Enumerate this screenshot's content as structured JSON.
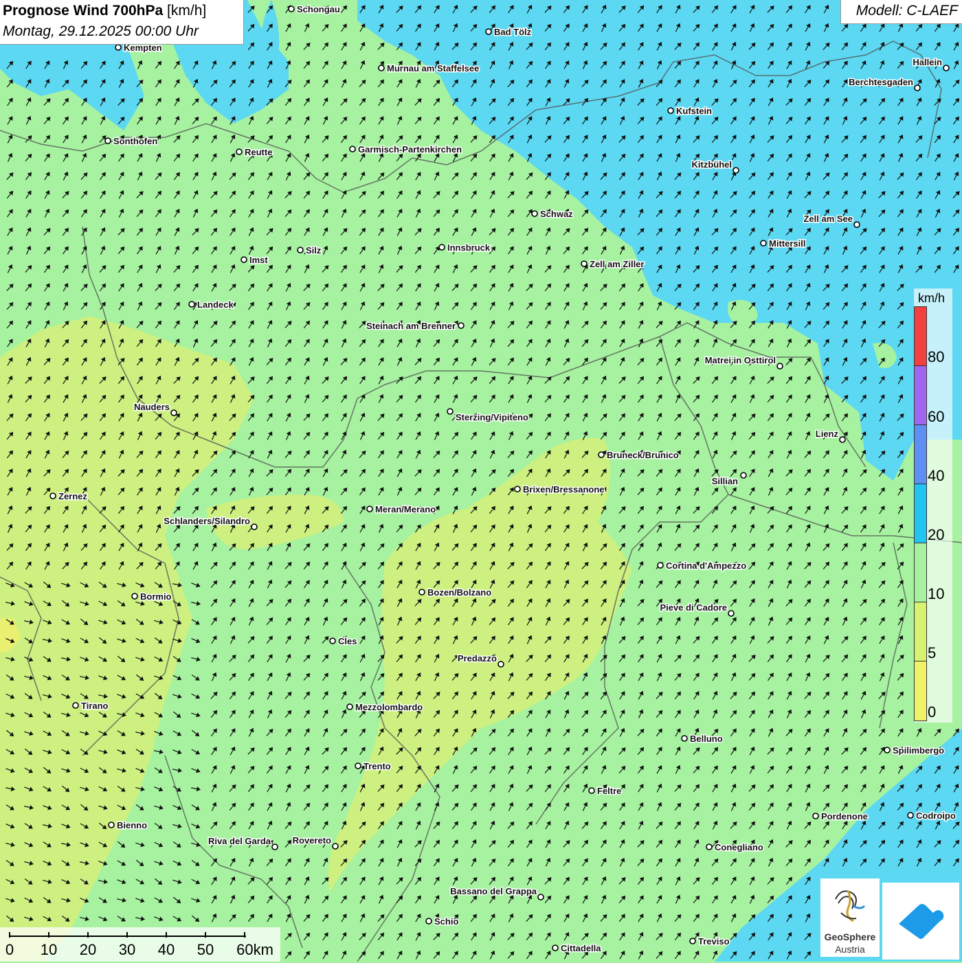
{
  "title": {
    "main_bold": "Prognose Wind 700hPa",
    "unit": "[km/h]",
    "date": "Montag, 29.12.2025 00:00 Uhr"
  },
  "model": "Modell: C-LAEF",
  "legend": {
    "unit": "km/h",
    "labels": [
      "80",
      "60",
      "40",
      "20",
      "10",
      "5",
      "0"
    ],
    "colors": {
      "above_80": "#f24040",
      "60_80": "#a066f0",
      "40_60": "#5e8ff2",
      "20_40": "#22c4f2",
      "10_20": "#a6f2a0",
      "5_10": "#d8f270",
      "0_5": "#f2f26a"
    }
  },
  "scale_bar": {
    "labels": [
      "0",
      "10",
      "20",
      "30",
      "40",
      "50",
      "60km"
    ]
  },
  "logo": {
    "line1": "GeoSphere",
    "line2": "Austria"
  },
  "wind_field": {
    "prevailing_direction": "from north-east",
    "speed_range_kmh": "5-40"
  },
  "cities": [
    {
      "name": "Schongau"
    },
    {
      "name": "Bad Tölz"
    },
    {
      "name": "Kempten"
    },
    {
      "name": "Murnau am Staffelsee"
    },
    {
      "name": "Hallein"
    },
    {
      "name": "Berchtesgaden"
    },
    {
      "name": "Kufstein"
    },
    {
      "name": "Sonthofen"
    },
    {
      "name": "Reutte"
    },
    {
      "name": "Garmisch-Partenkirchen"
    },
    {
      "name": "Kitzbühel"
    },
    {
      "name": "Schwaz"
    },
    {
      "name": "Zell am See"
    },
    {
      "name": "Mittersill"
    },
    {
      "name": "Silz"
    },
    {
      "name": "Innsbruck"
    },
    {
      "name": "Imst"
    },
    {
      "name": "Zell am Ziller"
    },
    {
      "name": "Landeck"
    },
    {
      "name": "Steinach am Brenner"
    },
    {
      "name": "Matrei in Osttirol"
    },
    {
      "name": "Nauders"
    },
    {
      "name": "Sterzing/Vipiteno"
    },
    {
      "name": "Lienz"
    },
    {
      "name": "Bruneck/Brunico"
    },
    {
      "name": "Sillian"
    },
    {
      "name": "Zernez"
    },
    {
      "name": "Brixen/Bressanone"
    },
    {
      "name": "Meran/Merano"
    },
    {
      "name": "Schlanders/Silandro"
    },
    {
      "name": "Cortina d'Ampezzo"
    },
    {
      "name": "Bozen/Bolzano"
    },
    {
      "name": "Bormio"
    },
    {
      "name": "Pieve di Cadore"
    },
    {
      "name": "Cles"
    },
    {
      "name": "Predazzo"
    },
    {
      "name": "Tirano"
    },
    {
      "name": "Mezzolombardo"
    },
    {
      "name": "Belluno"
    },
    {
      "name": "Spilimbergo"
    },
    {
      "name": "Trento"
    },
    {
      "name": "Feltre"
    },
    {
      "name": "Bienno"
    },
    {
      "name": "Pordenone"
    },
    {
      "name": "Codroipo"
    },
    {
      "name": "Riva del Garda"
    },
    {
      "name": "Rovereto"
    },
    {
      "name": "Conegliano"
    },
    {
      "name": "Bassano del Grappa"
    },
    {
      "name": "Schio"
    },
    {
      "name": "Treviso"
    },
    {
      "name": "Cittadella"
    }
  ]
}
